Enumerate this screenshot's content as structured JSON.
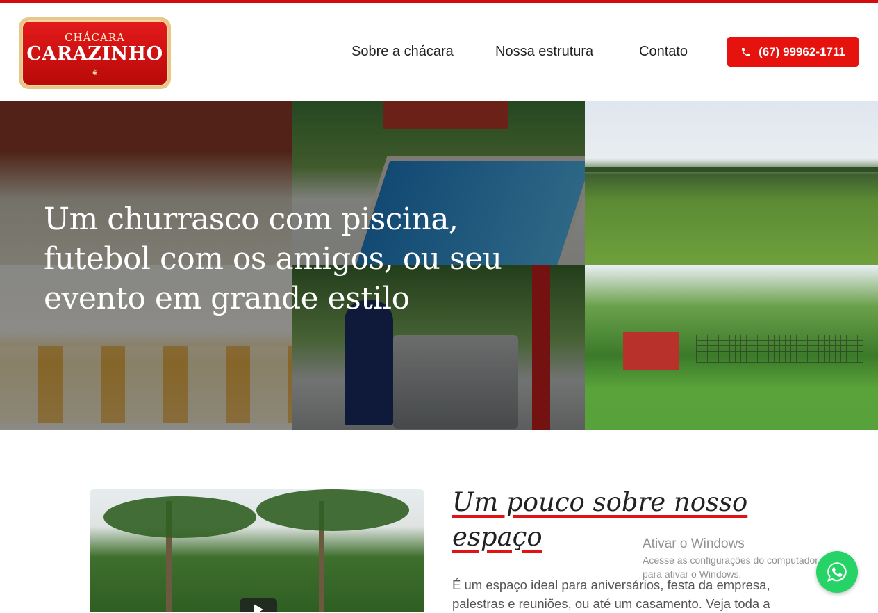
{
  "logo": {
    "line1": "CHÁCARA",
    "line2": "CARAZINHO",
    "ornament": "❦"
  },
  "nav": {
    "items": [
      {
        "label": "Sobre a chácara"
      },
      {
        "label": "Nossa estrutura"
      },
      {
        "label": "Contato"
      }
    ],
    "phone_label": "(67) 99962-1711",
    "phone_icon": "phone-icon"
  },
  "hero": {
    "title": "Um churrasco com piscina, futebol com os amigos, ou seu evento em grande estilo"
  },
  "about": {
    "title": "Um pouco sobre nosso espaço",
    "text": "É um espaço ideal para aniversários, festa da empresa, palestras e reuniões, ou até um casamento. Veja toda a"
  },
  "watermark": {
    "title": "Ativar o Windows",
    "subtitle": "Acesse as configurações do computador para ativar o Windows."
  },
  "colors": {
    "accent": "#e5120e",
    "whatsapp": "#25d366",
    "topbar": "#d40b0b"
  },
  "icons": {
    "play": "play-icon",
    "whatsapp": "whatsapp-icon"
  }
}
